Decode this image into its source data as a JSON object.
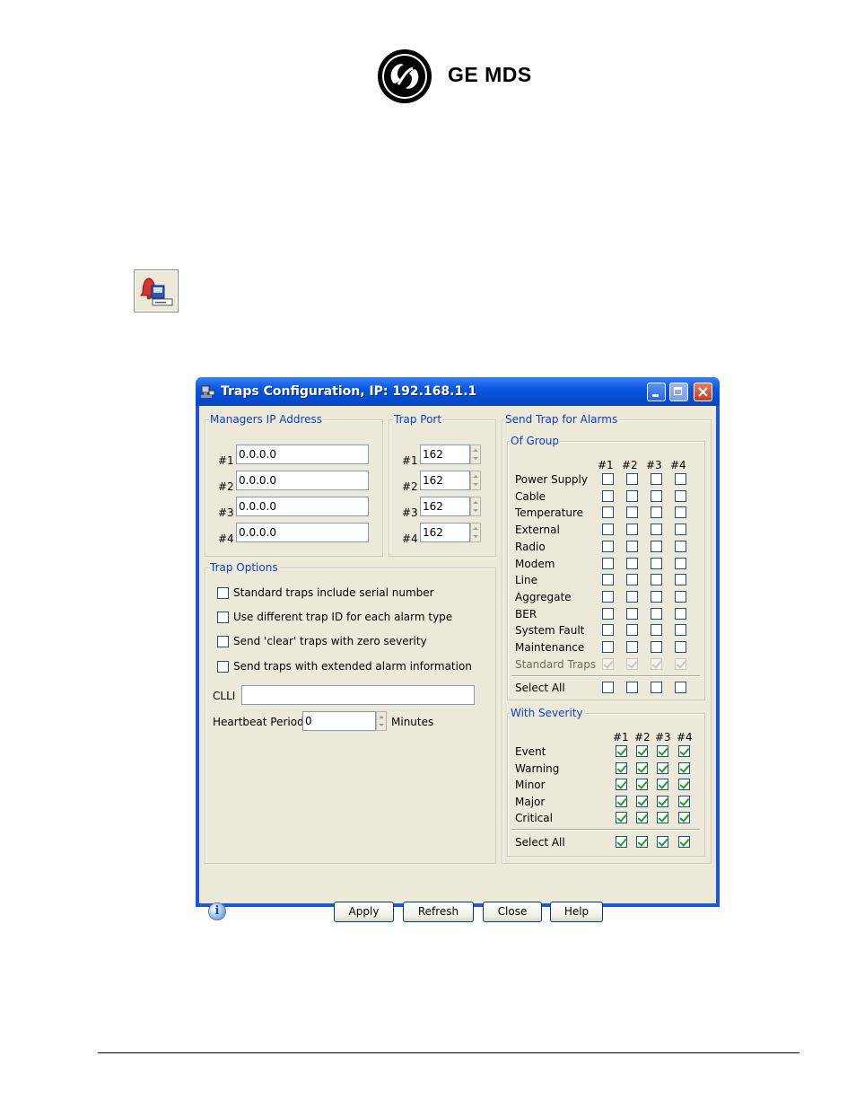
{
  "header": {
    "brand": "GE MDS",
    "logo_icon": "ge-monogram-icon"
  },
  "toolbar_icon": "trap-alarm-bell-icon",
  "window": {
    "title": "Traps Configuration, IP: 192.168.1.1",
    "managers": {
      "title": "Managers IP Address",
      "rows": [
        {
          "label": "#1",
          "value": "0.0.0.0"
        },
        {
          "label": "#2",
          "value": "0.0.0.0"
        },
        {
          "label": "#3",
          "value": "0.0.0.0"
        },
        {
          "label": "#4",
          "value": "0.0.0.0"
        }
      ]
    },
    "trap_port": {
      "title": "Trap Port",
      "rows": [
        {
          "label": "#1",
          "value": "162"
        },
        {
          "label": "#2",
          "value": "162"
        },
        {
          "label": "#3",
          "value": "162"
        },
        {
          "label": "#4",
          "value": "162"
        }
      ]
    },
    "trap_options": {
      "title": "Trap Options",
      "options": [
        {
          "label": "Standard traps include serial number",
          "checked": false
        },
        {
          "label": "Use different trap ID for each alarm type",
          "checked": false
        },
        {
          "label": "Send 'clear' traps with zero severity",
          "checked": false
        },
        {
          "label": "Send traps with extended alarm information",
          "checked": false
        }
      ],
      "clli_label": "CLLI",
      "clli_value": "",
      "heartbeat_label": "Heartbeat Period",
      "heartbeat_value": "0",
      "heartbeat_unit": "Minutes"
    },
    "send_trap": {
      "title": "Send Trap for Alarms",
      "of_group": {
        "title": "Of Group",
        "columns": [
          "#1",
          "#2",
          "#3",
          "#4"
        ],
        "rows": [
          "Power Supply",
          "Cable",
          "Temperature",
          "External",
          "Radio",
          "Modem",
          "Line",
          "Aggregate",
          "BER",
          "System Fault",
          "Maintenance"
        ],
        "standard_traps_label": "Standard Traps",
        "select_all_label": "Select All"
      },
      "with_severity": {
        "title": "With Severity",
        "columns": [
          "#1",
          "#2",
          "#3",
          "#4"
        ],
        "rows": [
          "Event",
          "Warning",
          "Minor",
          "Major",
          "Critical"
        ],
        "select_all_label": "Select All"
      }
    },
    "buttons": {
      "apply": "Apply",
      "refresh": "Refresh",
      "close": "Close",
      "help": "Help"
    },
    "info_glyph": "i"
  }
}
